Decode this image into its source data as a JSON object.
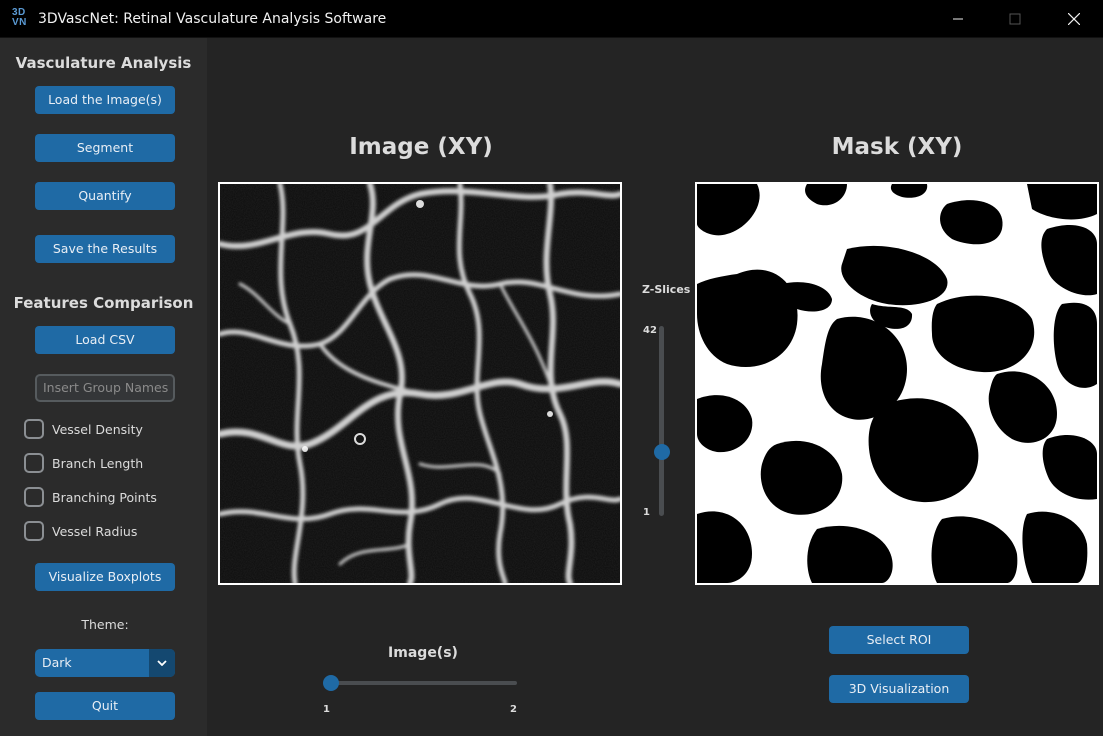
{
  "window": {
    "title": "3DVascNet: Retinal Vasculature Analysis Software",
    "logo_top": "3D",
    "logo_bottom": "VN",
    "minimize_icon": "minimize-icon",
    "maximize_icon": "maximize-icon",
    "close_icon": "close-icon"
  },
  "sidebar": {
    "analysis_title": "Vasculature Analysis",
    "load_images_label": "Load the Image(s)",
    "segment_label": "Segment",
    "quantify_label": "Quantify",
    "save_results_label": "Save the Results",
    "comparison_title": "Features Comparison",
    "load_csv_label": "Load CSV",
    "group_names_placeholder": "Insert Group Names",
    "features": [
      {
        "label": "Vessel Density",
        "checked": false
      },
      {
        "label": "Branch Length",
        "checked": false
      },
      {
        "label": "Branching Points",
        "checked": false
      },
      {
        "label": "Vessel Radius",
        "checked": false
      }
    ],
    "visualize_boxplots_label": "Visualize Boxplots",
    "theme_label": "Theme:",
    "theme_value": "Dark",
    "quit_label": "Quit"
  },
  "main": {
    "image_title": "Image (XY)",
    "mask_title": "Mask (XY)",
    "zslices": {
      "label": "Z-Slices",
      "max_label": "42",
      "min_label": "1",
      "min": 1,
      "max": 42,
      "value": 15
    },
    "images_slider": {
      "label": "Image(s)",
      "min_label": "1",
      "max_label": "2",
      "min": 1,
      "max": 2,
      "value": 1
    },
    "select_roi_label": "Select ROI",
    "visualization_3d_label": "3D Visualization"
  },
  "colors": {
    "accent": "#1f6aa5",
    "background": "#242424",
    "sidebar": "#2b2b2b",
    "titlebar": "#000000"
  }
}
